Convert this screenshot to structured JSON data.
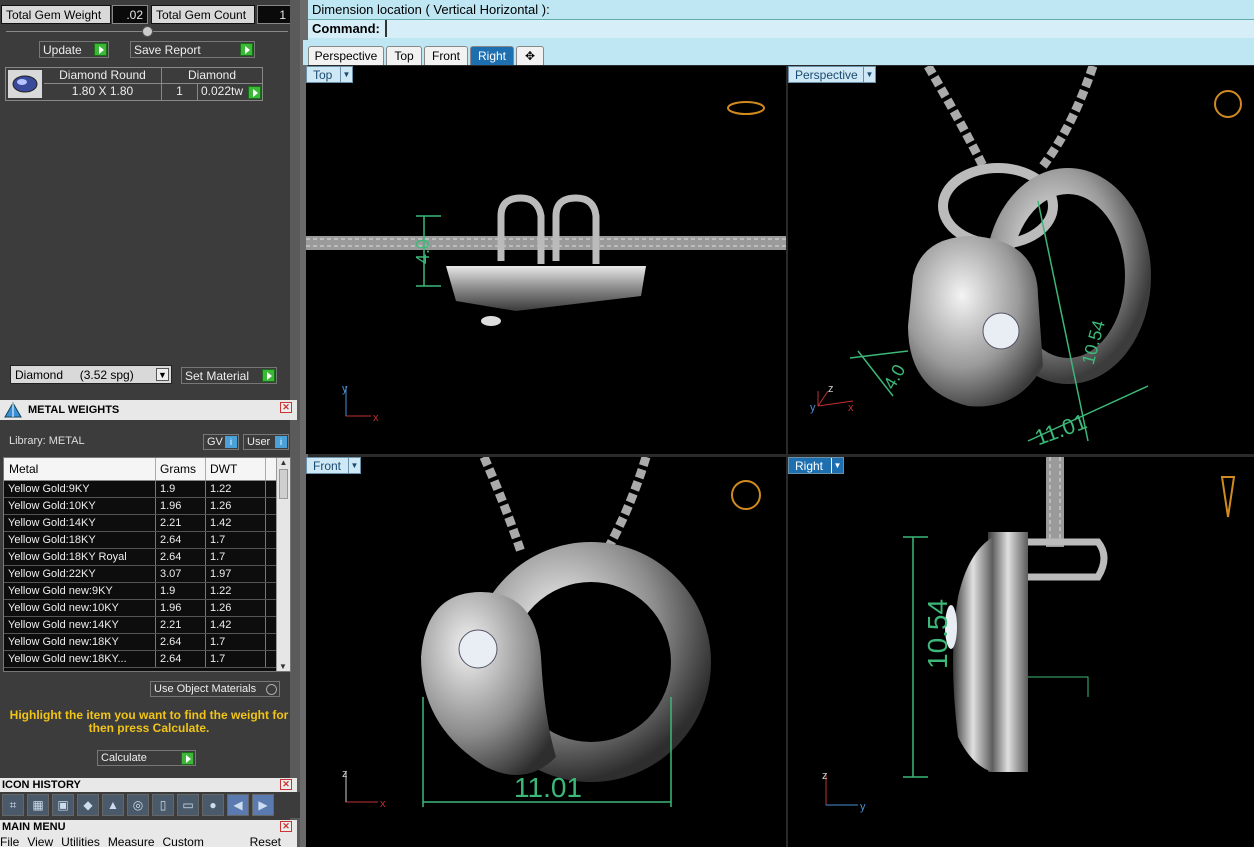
{
  "gem": {
    "total_weight_label": "Total Gem Weight",
    "total_weight_value": ".02",
    "total_count_label": "Total Gem Count",
    "total_count_value": "1",
    "update_label": "Update",
    "save_report_label": "Save Report",
    "row": {
      "shape": "Diamond Round",
      "material": "Diamond",
      "size": "1.80 X 1.80",
      "qty": "1",
      "weight": "0.022tw"
    },
    "material_select": "Diamond     (3.52 spg)",
    "set_material_label": "Set Material"
  },
  "metal_weights": {
    "title": "METAL WEIGHTS",
    "library": "Library: METAL",
    "gv_label": "GV",
    "user_label": "User",
    "columns": [
      "Metal",
      "Grams",
      "DWT"
    ],
    "rows": [
      [
        "Yellow Gold:9KY",
        "1.9",
        "1.22"
      ],
      [
        "Yellow Gold:10KY",
        "1.96",
        "1.26"
      ],
      [
        "Yellow Gold:14KY",
        "2.21",
        "1.42"
      ],
      [
        "Yellow Gold:18KY",
        "2.64",
        "1.7"
      ],
      [
        "Yellow Gold:18KY Royal",
        "2.64",
        "1.7"
      ],
      [
        "Yellow Gold:22KY",
        "3.07",
        "1.97"
      ],
      [
        "Yellow Gold new:9KY",
        "1.9",
        "1.22"
      ],
      [
        "Yellow Gold new:10KY",
        "1.96",
        "1.26"
      ],
      [
        "Yellow Gold new:14KY",
        "2.21",
        "1.42"
      ],
      [
        "Yellow Gold new:18KY",
        "2.64",
        "1.7"
      ],
      [
        "Yellow Gold new:18KY...",
        "2.64",
        "1.7"
      ]
    ],
    "use_object_materials": "Use Object Materials",
    "hint": "Highlight the item you want to find the weight for then press Calculate.",
    "calculate_label": "Calculate"
  },
  "icon_history": {
    "title": "ICON HISTORY"
  },
  "main_menu": {
    "title": "MAIN MENU",
    "items": [
      "File",
      "View",
      "Utilities",
      "Measure",
      "Custom"
    ],
    "reset": "Reset"
  },
  "command": {
    "prompt_line": "Dimension location ( Vertical  Horizontal ):",
    "label": "Command:"
  },
  "tabs": [
    "Perspective",
    "Top",
    "Front",
    "Right"
  ],
  "add_tab_glyph": "✥",
  "viewports": {
    "top": {
      "label": "Top",
      "dim": "4.0"
    },
    "perspective": {
      "label": "Perspective",
      "dim_a": "4.0",
      "dim_b": "10.54",
      "dim_c": "11.01"
    },
    "front": {
      "label": "Front",
      "dim": "11.01"
    },
    "right": {
      "label": "Right",
      "dim": "10.54"
    }
  },
  "axes": {
    "x": "x",
    "y": "y",
    "z": "z"
  },
  "colors": {
    "accent": "#1d6fb0",
    "dim_green": "#3cb878",
    "panel": "#3c3c3c",
    "hint_text": "#f0c419"
  }
}
